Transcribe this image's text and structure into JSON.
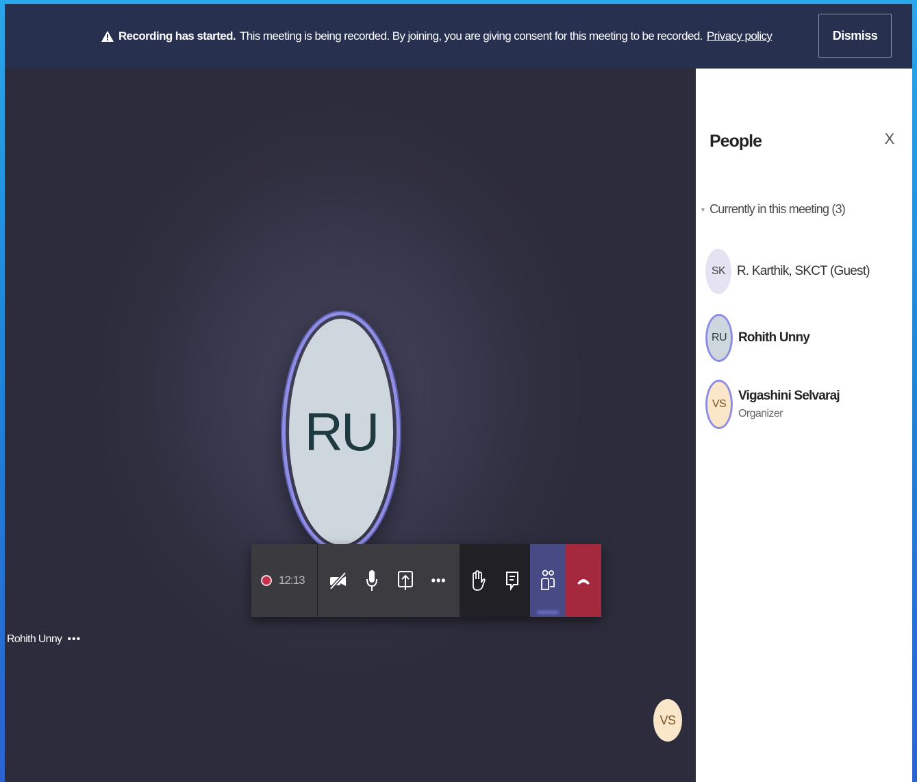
{
  "banner": {
    "title": "Recording has started.",
    "message": "This meeting is being recorded. By joining, you are giving consent for this meeting to be recorded.",
    "privacy_link": "Privacy policy",
    "dismiss_label": "Dismiss",
    "icon": "warning-icon"
  },
  "stage": {
    "main_avatar_initials": "RU",
    "self_name": "Rohith Unny",
    "self_more": "•••",
    "corner_avatar_initials": "VS"
  },
  "controls": {
    "recording_timer": "12:13",
    "more_label": "•••",
    "icons": [
      "recording-indicator-icon",
      "camera-off-icon",
      "microphone-icon",
      "share-screen-icon",
      "more-icon",
      "raise-hand-icon",
      "chat-icon",
      "people-icon",
      "hang-up-icon"
    ],
    "hangup_color": "#a4293d",
    "people_active_color": "#474a85"
  },
  "people_panel": {
    "title": "People",
    "close_label": "X",
    "section_label": "Currently in this meeting (3)",
    "participants": [
      {
        "initials": "SK",
        "name": "R. Karthik, SKCT (Guest)",
        "role": ""
      },
      {
        "initials": "RU",
        "name": "Rohith Unny",
        "role": ""
      },
      {
        "initials": "VS",
        "name": "Vigashini Selvaraj",
        "role": "Organizer"
      }
    ]
  },
  "colors": {
    "banner_bg": "#27314f",
    "stage_bg": "#2d2c3c",
    "accent_ring": "#8e8ee6",
    "outer_frame": "#1f86d8"
  }
}
